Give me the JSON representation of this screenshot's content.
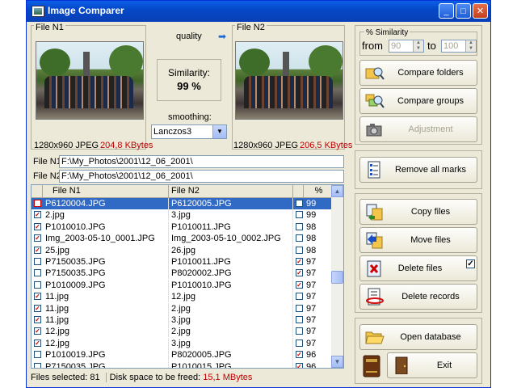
{
  "window": {
    "title": "Image Comparer"
  },
  "file1": {
    "label": "File N1",
    "info": "1280x960  JPEG",
    "size": "204,8 KBytes",
    "path_label": "File N1:",
    "path": "F:\\My_Photos\\2001\\12_06_2001\\"
  },
  "file2": {
    "label": "File N2",
    "info": "1280x960  JPEG",
    "size": "206,5 KBytes",
    "path_label": "File N2:",
    "path": "F:\\My_Photos\\2001\\12_06_2001\\"
  },
  "center": {
    "quality": "quality",
    "similarity_label": "Similarity:",
    "similarity_value": "99 %",
    "smoothing_label": "smoothing:",
    "smoothing_value": "Lanczos3"
  },
  "similarity_range": {
    "group_label": "% Similarity",
    "from_label": "from",
    "from_value": "90",
    "to_label": "to",
    "to_value": "100"
  },
  "buttons": {
    "compare_folders": "Compare folders",
    "compare_groups": "Compare groups",
    "adjustment": "Adjustment",
    "remove_marks": "Remove all marks",
    "copy_files": "Copy files",
    "move_files": "Move files",
    "delete_files": "Delete files",
    "delete_records": "Delete records",
    "open_database": "Open database",
    "exit": "Exit"
  },
  "table": {
    "columns": [
      "File N1",
      "File N2",
      "%"
    ],
    "rows": [
      {
        "f1": "P6120004.JPG",
        "c1": false,
        "f2": "P6120005.JPG",
        "c2": false,
        "pct": "99",
        "selected": true
      },
      {
        "f1": "2.jpg",
        "c1": true,
        "f2": "3.jpg",
        "c2": false,
        "pct": "99"
      },
      {
        "f1": "P1010010.JPG",
        "c1": true,
        "f2": "P1010011.JPG",
        "c2": false,
        "pct": "98"
      },
      {
        "f1": "Img_2003-05-10_0001.JPG",
        "c1": true,
        "f2": "Img_2003-05-10_0002.JPG",
        "c2": false,
        "pct": "98"
      },
      {
        "f1": "25.jpg",
        "c1": true,
        "f2": "26.jpg",
        "c2": false,
        "pct": "98"
      },
      {
        "f1": "P7150035.JPG",
        "c1": false,
        "f2": "P1010011.JPG",
        "c2": true,
        "pct": "97"
      },
      {
        "f1": "P7150035.JPG",
        "c1": false,
        "f2": "P8020002.JPG",
        "c2": true,
        "pct": "97"
      },
      {
        "f1": "P1010009.JPG",
        "c1": false,
        "f2": "P1010010.JPG",
        "c2": true,
        "pct": "97"
      },
      {
        "f1": "11.jpg",
        "c1": true,
        "f2": "12.jpg",
        "c2": false,
        "pct": "97"
      },
      {
        "f1": "11.jpg",
        "c1": true,
        "f2": "2.jpg",
        "c2": false,
        "pct": "97"
      },
      {
        "f1": "11.jpg",
        "c1": true,
        "f2": "3.jpg",
        "c2": false,
        "pct": "97"
      },
      {
        "f1": "12.jpg",
        "c1": true,
        "f2": "2.jpg",
        "c2": false,
        "pct": "97"
      },
      {
        "f1": "12.jpg",
        "c1": true,
        "f2": "3.jpg",
        "c2": false,
        "pct": "97"
      },
      {
        "f1": "P1010019.JPG",
        "c1": false,
        "f2": "P8020005.JPG",
        "c2": true,
        "pct": "96"
      },
      {
        "f1": "P7150035.JPG",
        "c1": false,
        "f2": "P1010015.JPG",
        "c2": true,
        "pct": "96"
      }
    ]
  },
  "status": {
    "selected": "Files selected: 81",
    "space_label": "Disk space to be freed:",
    "space_value": "15,1 MBytes"
  },
  "colors": {
    "title_bar": "#0a5fe6",
    "selection": "#316ac5",
    "size_text": "#c00000",
    "check_red": "#cc0000"
  }
}
